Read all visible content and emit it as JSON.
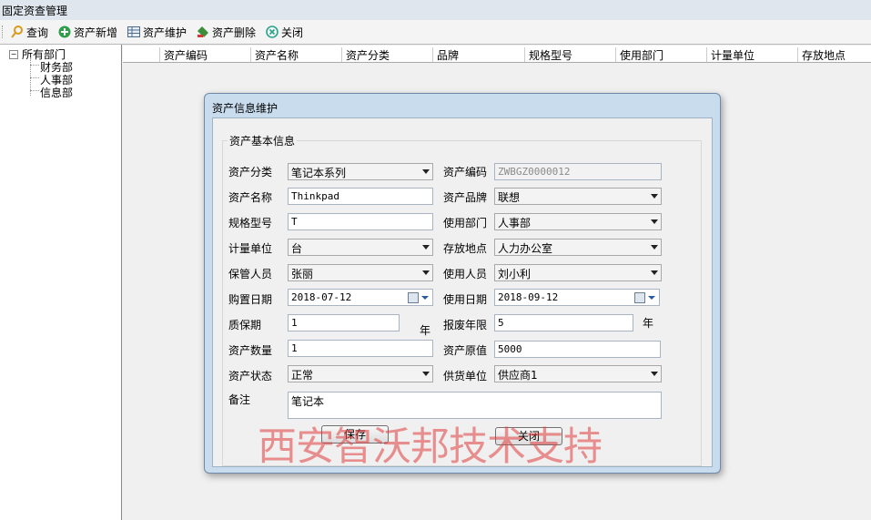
{
  "window": {
    "title": "固定资查管理"
  },
  "toolbar": {
    "query": "查询",
    "add": "资产新增",
    "maintain": "资产维护",
    "delete": "资产删除",
    "close": "关闭"
  },
  "tree": {
    "root": "所有部门",
    "expander": "−",
    "children": [
      "财务部",
      "人事部",
      "信息部"
    ]
  },
  "grid": {
    "columns": [
      "资产编码",
      "资产名称",
      "资产分类",
      "品牌",
      "规格型号",
      "使用部门",
      "计量单位",
      "存放地点"
    ]
  },
  "dialog": {
    "title": "资产信息维护",
    "group_title": "资产基本信息",
    "labels": {
      "category": "资产分类",
      "code": "资产编码",
      "name": "资产名称",
      "brand": "资产品牌",
      "spec": "规格型号",
      "dept": "使用部门",
      "unit": "计量单位",
      "location": "存放地点",
      "keeper": "保管人员",
      "user": "使用人员",
      "purchase_date": "购置日期",
      "use_date": "使用日期",
      "warranty": "质保期",
      "scrap_years": "报废年限",
      "quantity": "资产数量",
      "original_value": "资产原值",
      "status": "资产状态",
      "supplier": "供货单位",
      "remark": "备注",
      "year_unit": "年"
    },
    "values": {
      "category": "笔记本系列",
      "code": "ZWBGZ0000012",
      "name": "Thinkpad",
      "brand": "联想",
      "spec": "T",
      "dept": "人事部",
      "unit": "台",
      "location": "人力办公室",
      "keeper": "张丽",
      "user": "刘小利",
      "purchase_date": "2018-07-12",
      "use_date": "2018-09-12",
      "warranty": "1",
      "scrap_years": "5",
      "quantity": "1",
      "original_value": "5000",
      "status": "正常",
      "supplier": "供应商1",
      "remark": "笔记本"
    },
    "buttons": {
      "save": "保存",
      "close": "关闭"
    }
  },
  "watermark": "西安智沃邦技术支持",
  "colors": {
    "dialog_frame": "#c9dcee",
    "watermark": "#e23c3c"
  }
}
